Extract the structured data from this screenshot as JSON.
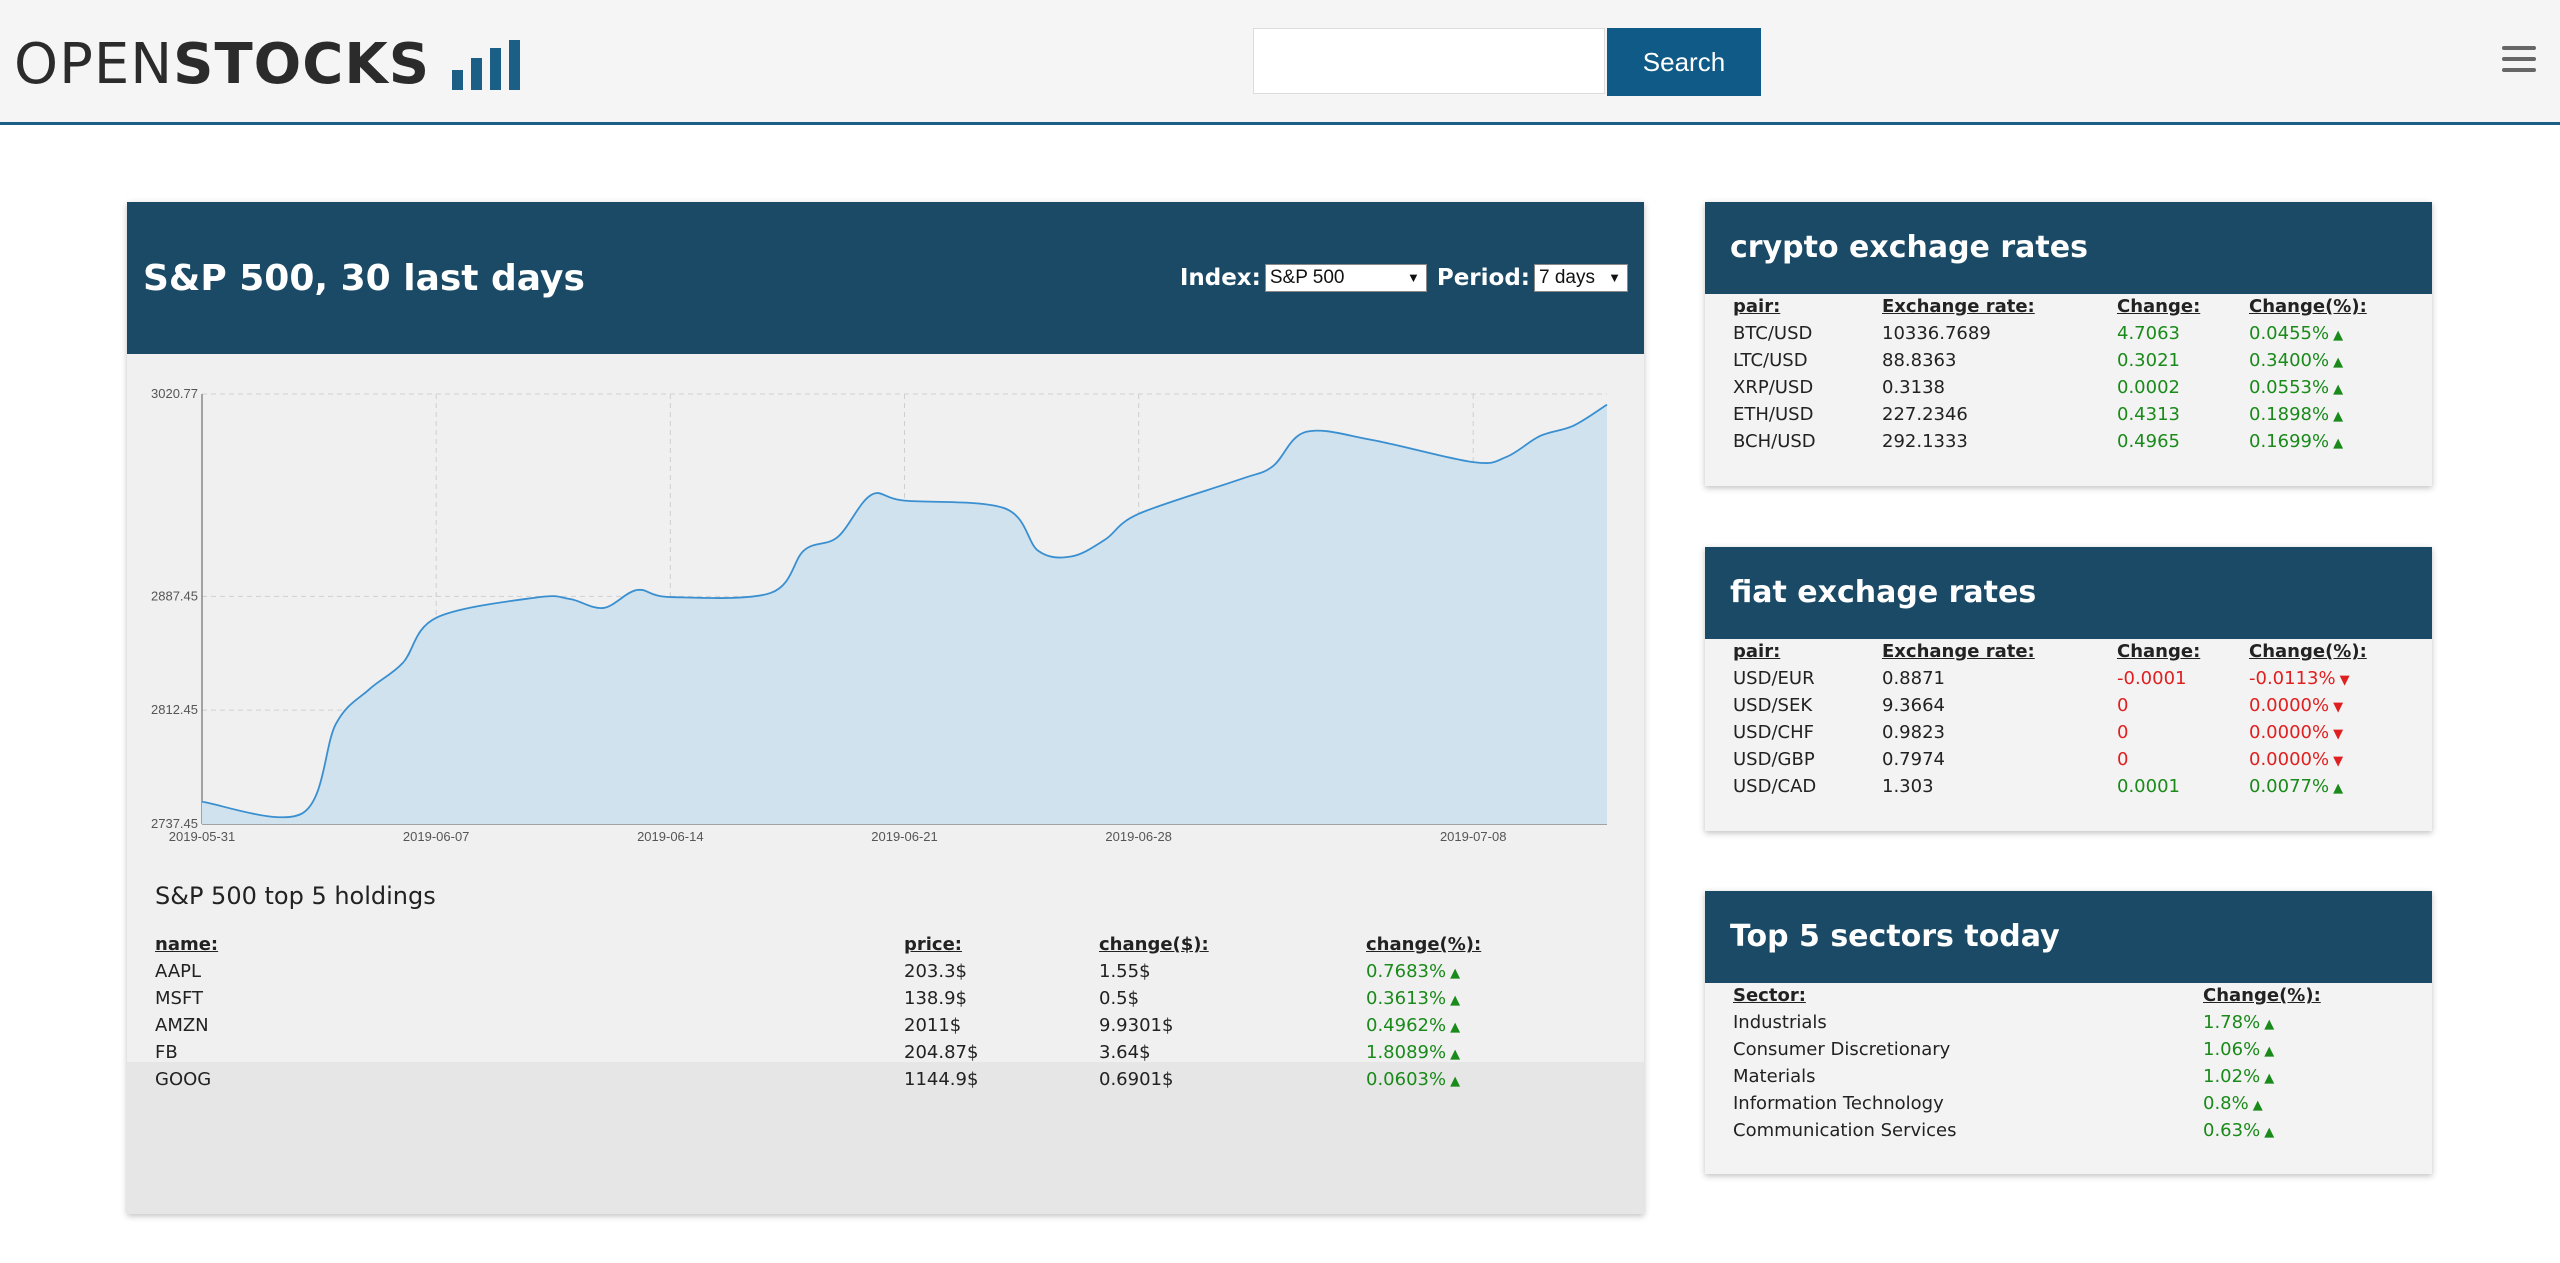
{
  "header": {
    "logo_open": "OPEN",
    "logo_stocks": "STOCKS",
    "search_placeholder": "",
    "search_label": "Search",
    "menu_icon": "hamburger-icon"
  },
  "colors": {
    "primary": "#1a4a66",
    "button": "#0f5a87",
    "positive": "#1a8a1a",
    "negative": "#e02020",
    "chart_line": "#3a8fd0",
    "chart_fill": "#d0e2ee"
  },
  "main": {
    "title": "S&P 500, 30 last days",
    "index_label": "Index:",
    "index_value": "S&P 500",
    "period_label": "Period:",
    "period_value": "7 days",
    "holdings_title": "S&P 500 top 5 holdings",
    "holdings": {
      "headers": [
        "name:",
        "price:",
        "change($):",
        "change(%):"
      ],
      "rows": [
        {
          "name": "AAPL",
          "price": "203.3$",
          "change": "1.55$",
          "pct": "0.7683%"
        },
        {
          "name": "MSFT",
          "price": "138.9$",
          "change": "0.5$",
          "pct": "0.3613%"
        },
        {
          "name": "AMZN",
          "price": "2011$",
          "change": "9.9301$",
          "pct": "0.4962%"
        },
        {
          "name": "FB",
          "price": "204.87$",
          "change": "3.64$",
          "pct": "1.8089%"
        },
        {
          "name": "GOOG",
          "price": "1144.9$",
          "change": "0.6901$",
          "pct": "0.0603%"
        }
      ]
    }
  },
  "chart_data": {
    "type": "area",
    "title": "",
    "xlabel": "",
    "ylabel": "",
    "y_ticks": [
      "3020.77",
      "2887.45",
      "2812.45",
      "2737.45"
    ],
    "x_ticks": [
      "2019-05-31",
      "2019-06-07",
      "2019-06-14",
      "2019-06-21",
      "2019-06-28",
      "2019-07-08"
    ],
    "ylim": [
      2737.45,
      3020.77
    ],
    "grid": true,
    "series": [
      {
        "x": [
          "2019-05-31",
          "2019-06-03",
          "2019-06-04",
          "2019-06-05",
          "2019-06-06",
          "2019-06-07",
          "2019-06-10",
          "2019-06-11",
          "2019-06-12",
          "2019-06-13",
          "2019-06-14",
          "2019-06-17",
          "2019-06-18",
          "2019-06-19",
          "2019-06-20",
          "2019-06-21",
          "2019-06-24",
          "2019-06-25",
          "2019-06-26",
          "2019-06-27",
          "2019-06-28",
          "2019-07-01",
          "2019-07-02",
          "2019-07-03",
          "2019-07-05",
          "2019-07-08",
          "2019-07-09",
          "2019-07-10",
          "2019-07-11",
          "2019-07-12"
        ],
        "values": [
          2752.1,
          2744.5,
          2803.3,
          2826.2,
          2843.5,
          2873.3,
          2886.7,
          2885.7,
          2879.8,
          2891.6,
          2886.98,
          2889.7,
          2917.8,
          2926.5,
          2954.2,
          2950.5,
          2945.4,
          2917.4,
          2913.8,
          2924.9,
          2941.8,
          2964.3,
          2973.0,
          2995.8,
          2990.4,
          2975.9,
          2979.4,
          2993.1,
          2999.9,
          3013.8
        ]
      }
    ]
  },
  "crypto": {
    "title": "crypto exchage rates",
    "headers": [
      "pair:",
      "Exchange rate:",
      "Change:",
      "Change(%):"
    ],
    "rows": [
      {
        "pair": "BTC/USD",
        "rate": "10336.7689",
        "change": "4.7063",
        "pct": "0.0455%",
        "dir": "up"
      },
      {
        "pair": "LTC/USD",
        "rate": "88.8363",
        "change": "0.3021",
        "pct": "0.3400%",
        "dir": "up"
      },
      {
        "pair": "XRP/USD",
        "rate": "0.3138",
        "change": "0.0002",
        "pct": "0.0553%",
        "dir": "up"
      },
      {
        "pair": "ETH/USD",
        "rate": "227.2346",
        "change": "0.4313",
        "pct": "0.1898%",
        "dir": "up"
      },
      {
        "pair": "BCH/USD",
        "rate": "292.1333",
        "change": "0.4965",
        "pct": "0.1699%",
        "dir": "up"
      }
    ]
  },
  "fiat": {
    "title": "fiat exchage rates",
    "headers": [
      "pair:",
      "Exchange rate:",
      "Change:",
      "Change(%):"
    ],
    "rows": [
      {
        "pair": "USD/EUR",
        "rate": "0.8871",
        "change": "-0.0001",
        "pct": "-0.0113%",
        "dir": "down"
      },
      {
        "pair": "USD/SEK",
        "rate": "9.3664",
        "change": "0",
        "pct": "0.0000%",
        "dir": "down"
      },
      {
        "pair": "USD/CHF",
        "rate": "0.9823",
        "change": "0",
        "pct": "0.0000%",
        "dir": "down"
      },
      {
        "pair": "USD/GBP",
        "rate": "0.7974",
        "change": "0",
        "pct": "0.0000%",
        "dir": "down"
      },
      {
        "pair": "USD/CAD",
        "rate": "1.303",
        "change": "0.0001",
        "pct": "0.0077%",
        "dir": "up"
      }
    ]
  },
  "sectors": {
    "title": "Top 5 sectors today",
    "headers": [
      "Sector:",
      "Change(%):"
    ],
    "rows": [
      {
        "sector": "Industrials",
        "pct": "1.78%",
        "dir": "up"
      },
      {
        "sector": "Consumer Discretionary",
        "pct": "1.06%",
        "dir": "up"
      },
      {
        "sector": "Materials",
        "pct": "1.02%",
        "dir": "up"
      },
      {
        "sector": "Information Technology",
        "pct": "0.8%",
        "dir": "up"
      },
      {
        "sector": "Communication Services",
        "pct": "0.63%",
        "dir": "up"
      }
    ]
  }
}
